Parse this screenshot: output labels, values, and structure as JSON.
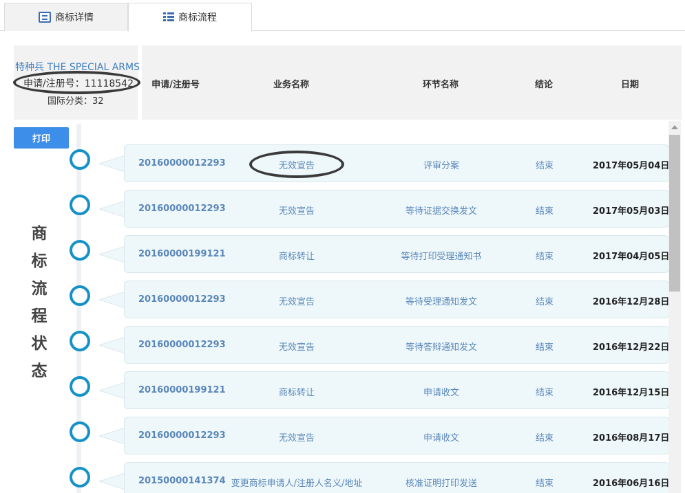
{
  "tabs": [
    {
      "label": "商标详情",
      "icon": "document-icon",
      "active": false
    },
    {
      "label": "商标流程",
      "icon": "list-icon",
      "active": true
    }
  ],
  "mark": {
    "name": "特种兵 THE SPECIAL ARMS",
    "reg_no": "申请/注册号：11118542",
    "intl_class": "国际分类：32"
  },
  "columns": {
    "app_no": "申请/注册号",
    "business": "业务名称",
    "step": "环节名称",
    "result": "结论",
    "date": "日期"
  },
  "print_label": "打印",
  "side_title": "商标流程状态",
  "colors": {
    "accent": "#3d8ee8",
    "link": "#5a86b8",
    "circle": "#1591c8",
    "row_bg": "#eef8fb"
  },
  "rows": [
    {
      "app_no": "20160000012293",
      "business": "无效宣告",
      "step": "评审分案",
      "result": "结束",
      "date": "2017年05月04日"
    },
    {
      "app_no": "20160000012293",
      "business": "无效宣告",
      "step": "等待证据交换发文",
      "result": "结束",
      "date": "2017年05月03日"
    },
    {
      "app_no": "20160000199121",
      "business": "商标转让",
      "step": "等待打印受理通知书",
      "result": "结束",
      "date": "2017年04月05日"
    },
    {
      "app_no": "20160000012293",
      "business": "无效宣告",
      "step": "等待受理通知发文",
      "result": "结束",
      "date": "2016年12月28日"
    },
    {
      "app_no": "20160000012293",
      "business": "无效宣告",
      "step": "等待答辩通知发文",
      "result": "结束",
      "date": "2016年12月22日"
    },
    {
      "app_no": "20160000199121",
      "business": "商标转让",
      "step": "申请收文",
      "result": "结束",
      "date": "2016年12月15日"
    },
    {
      "app_no": "20160000012293",
      "business": "无效宣告",
      "step": "申请收文",
      "result": "结束",
      "date": "2016年08月17日"
    },
    {
      "app_no": "20150000141374",
      "business": "变更商标申请人/注册人名义/地址",
      "step": "核准证明打印发送",
      "result": "结束",
      "date": "2016年06月16日"
    }
  ]
}
